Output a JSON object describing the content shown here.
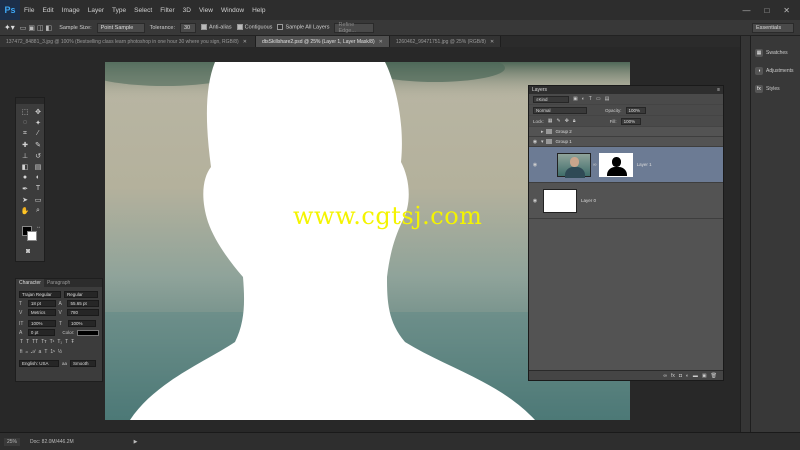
{
  "app": {
    "logo": "Ps"
  },
  "menu": [
    "File",
    "Edit",
    "Image",
    "Layer",
    "Type",
    "Select",
    "Filter",
    "3D",
    "View",
    "Window",
    "Help"
  ],
  "window_controls": [
    "—",
    "□",
    "✕"
  ],
  "options_bar": {
    "sample_size_label": "Sample Size:",
    "sample_size_value": "Point Sample",
    "tolerance_label": "Tolerance:",
    "tolerance_value": "30",
    "anti_alias": "Anti-alias",
    "contiguous": "Contiguous",
    "sample_all_layers": "Sample All Layers",
    "refine_edge": "Refine Edge...",
    "workspace": "Essentials"
  },
  "tabs": [
    {
      "label": "137472_84881_3.jpg @ 100% (Bestselling class learn photoshop in one hour 30 where you sign, RGB/8)",
      "active": false
    },
    {
      "label": "dtsSkillshare2.psd @ 25% (Layer 1, Layer Mask/8)",
      "active": true
    },
    {
      "label": "1260462_99471751.jpg @ 25% (RGB/8)",
      "active": false
    }
  ],
  "watermark": "www.cgtsj.com",
  "character_panel": {
    "tabs": [
      "Character",
      "Paragraph"
    ],
    "font_family": "Trajan Regular",
    "font_style": "Regular",
    "font_size": "18 pt",
    "leading": "55.65 pt",
    "kerning": "Metrics",
    "tracking": "780",
    "vertical_scale": "100%",
    "horizontal_scale": "100%",
    "baseline_shift": "0 pt",
    "color_label": "Color:",
    "language": "English: USA",
    "aa_label": "aa",
    "antialias": "Smooth"
  },
  "right_panel": {
    "items": [
      {
        "label": "Swatches",
        "icon": "swatches-icon"
      },
      {
        "label": "Adjustments",
        "icon": "adjustments-icon"
      },
      {
        "label": "Styles",
        "icon": "styles-icon"
      }
    ]
  },
  "layers_panel": {
    "title": "Layers",
    "filter": "Kind",
    "blend_mode": "Normal",
    "opacity_label": "Opacity:",
    "opacity": "100%",
    "lock_label": "Lock:",
    "fill_label": "Fill:",
    "fill": "100%",
    "layers": [
      {
        "name": "Group 2",
        "type": "group",
        "visible": false,
        "expanded": false
      },
      {
        "name": "Group 1",
        "type": "group",
        "visible": true,
        "expanded": true
      },
      {
        "name": "Layer 1",
        "type": "masked",
        "visible": true,
        "selected": true
      },
      {
        "name": "Layer 0",
        "type": "plain",
        "visible": true,
        "selected": false
      }
    ]
  },
  "status": {
    "zoom": "25%",
    "doc": "Doc: 82.0M/446.2M"
  },
  "colors": {
    "foreground": "#000000",
    "background": "#ffffff",
    "selected_layer": "#6c7b94",
    "watermark": "#f4f400"
  }
}
